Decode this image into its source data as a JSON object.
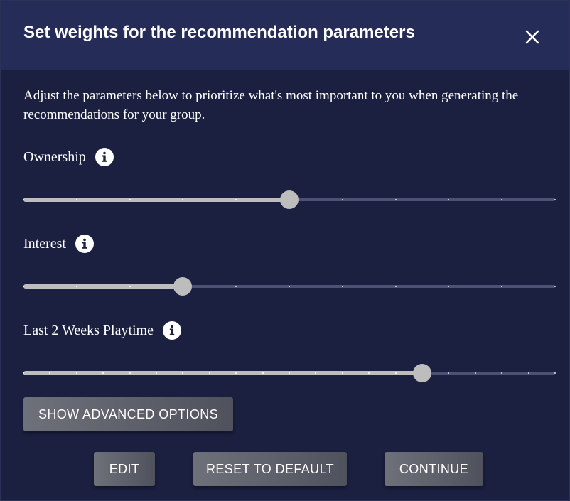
{
  "dialog": {
    "title": "Set weights for the recommendation parameters",
    "description": "Adjust the parameters below to prioritize what's most important to you when generating the recommendations for your group."
  },
  "parameters": [
    {
      "label": "Ownership",
      "value": 5,
      "min": 0,
      "max": 10,
      "step": 1,
      "icon": "info-icon"
    },
    {
      "label": "Interest",
      "value": 3,
      "min": 0,
      "max": 10,
      "step": 1,
      "icon": "info-icon"
    },
    {
      "label": "Last 2 Weeks Playtime",
      "value": 15,
      "min": 0,
      "max": 20,
      "step": 1,
      "icon": "info-icon"
    }
  ],
  "buttons": {
    "advanced": "SHOW ADVANCED OPTIONS",
    "edit": "EDIT",
    "reset": "RESET TO DEFAULT",
    "continue": "CONTINUE"
  },
  "icons": {
    "close": "close-icon",
    "info": "info-icon"
  },
  "colors": {
    "background": "#1b1f40",
    "header": "#262c58",
    "slider_active": "#bdbdbd",
    "slider_rail": "#4c5175",
    "button": "#5c5e68"
  }
}
